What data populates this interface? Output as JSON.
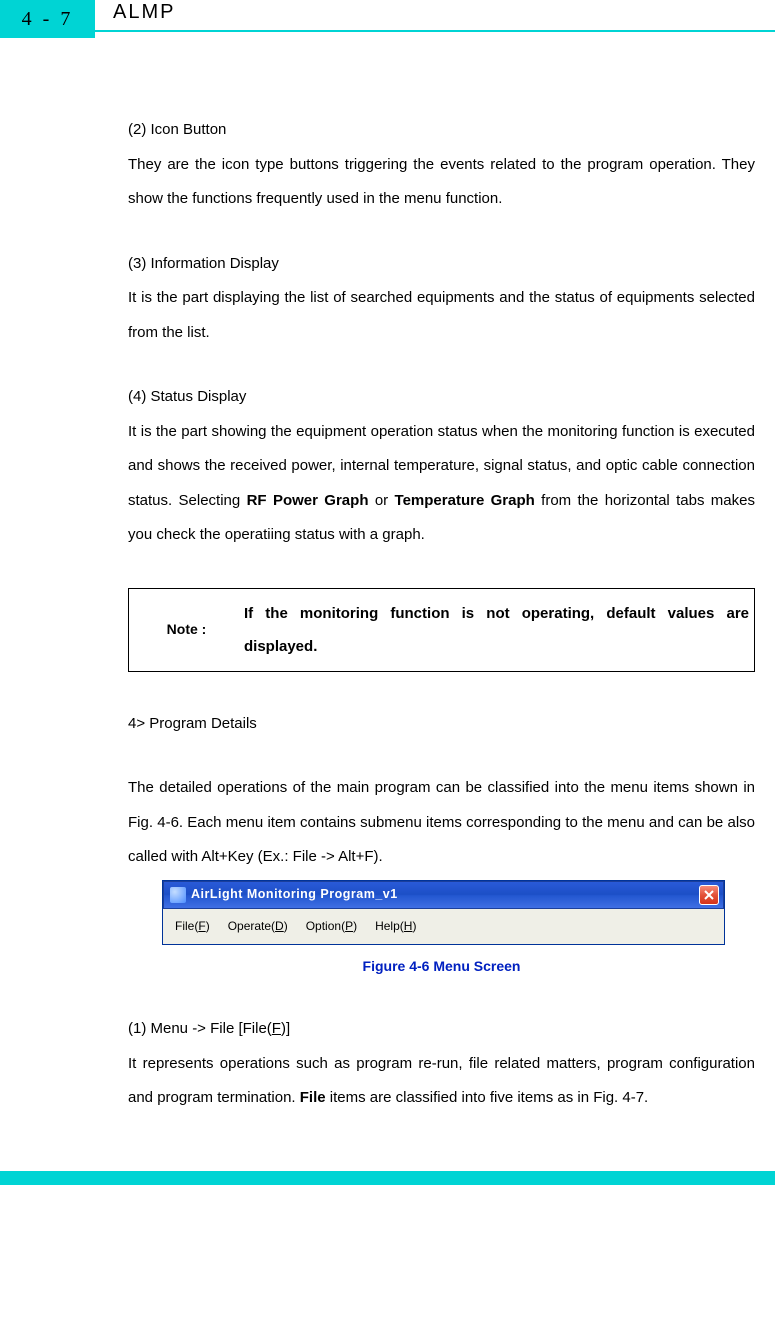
{
  "header": {
    "page_number": "4 - 7",
    "title": "ALMP"
  },
  "sections": {
    "s2": {
      "heading": "(2) Icon Button",
      "body": "They are the icon type buttons triggering the events related to the program operation. They show the functions frequently used in the menu function."
    },
    "s3": {
      "heading": "(3) Information Display",
      "body": "It is the part displaying the list of searched equipments and the status of equipments selected from the list."
    },
    "s4": {
      "heading": "(4) Status Display",
      "body_pre": "It is the part showing the equipment operation status when the monitoring function is executed and shows the received power, internal temperature, signal status, and optic cable connection status. Selecting ",
      "bold1": "RF Power Graph",
      "mid": " or ",
      "bold2": "Temperature Graph",
      "body_post": " from the horizontal tabs makes you check the operatiing status with a graph."
    }
  },
  "note": {
    "label": "Note :",
    "text": "If the monitoring function is not operating, default values are displayed."
  },
  "program_details": {
    "heading": "4> Program Details",
    "body": "The detailed operations of the main program can be classified into the menu items shown in Fig. 4-6. Each menu item contains submenu items corresponding to the menu and can be also called with Alt+Key (Ex.: File -> Alt+F)."
  },
  "figure": {
    "window_title": "AirLight Monitoring Program_v1",
    "menu": {
      "file_pre": "File(",
      "file_u": "F",
      "file_post": ")",
      "operate_pre": "Operate(",
      "operate_u": "D",
      "operate_post": ")",
      "option_pre": "Option(",
      "option_u": "P",
      "option_post": ")",
      "help_pre": "Help(",
      "help_u": "H",
      "help_post": ")"
    },
    "caption": "Figure 4-6 Menu Screen"
  },
  "menu_file": {
    "heading_pre": "(1) Menu -> File [File(",
    "heading_u": "F",
    "heading_post": ")]",
    "body_pre": "It represents operations such as program re-run, file related matters, program configuration and program termination. ",
    "bold": "File",
    "body_post": " items are classified into five items as in Fig. 4-7."
  }
}
